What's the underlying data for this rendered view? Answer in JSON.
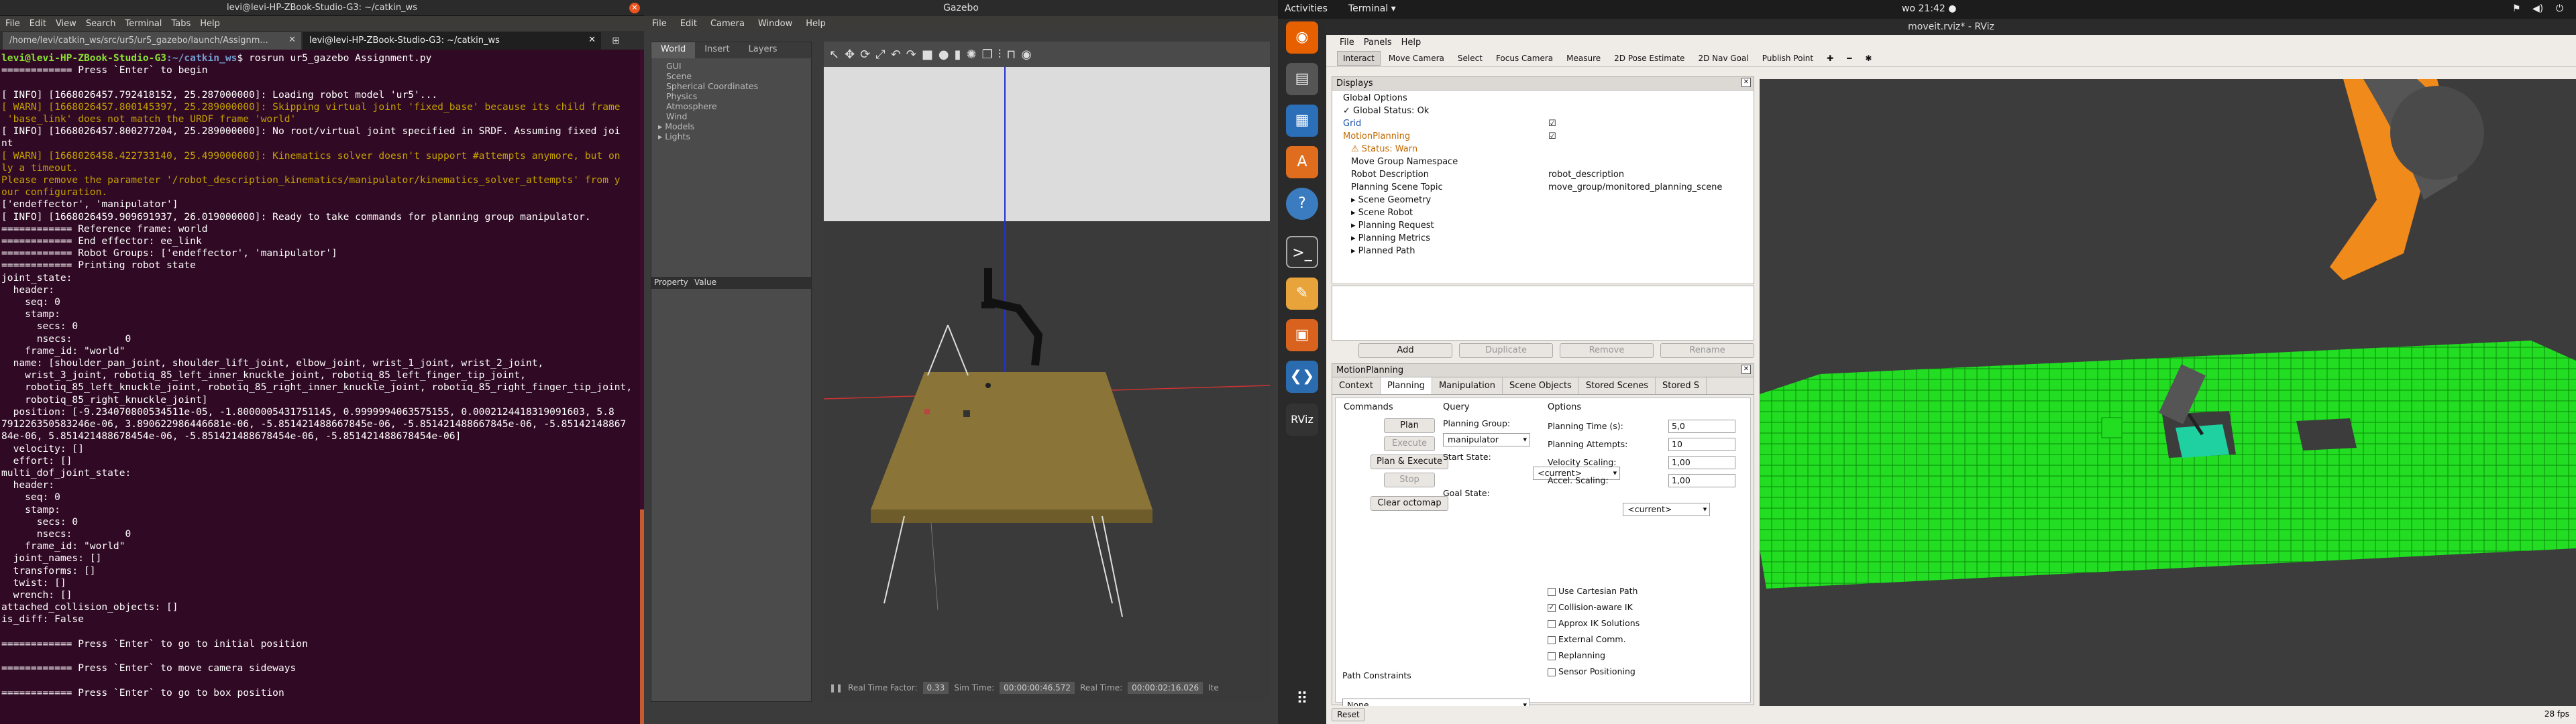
{
  "terminal": {
    "title": "levi@levi-HP-ZBook-Studio-G3: ~/catkin_ws",
    "menu": [
      "File",
      "Edit",
      "View",
      "Search",
      "Terminal",
      "Tabs",
      "Help"
    ],
    "tabs": [
      "/home/levi/catkin_ws/src/ur5/ur5_gazebo/launch/Assignm...",
      "levi@levi-HP-ZBook-Studio-G3: ~/catkin_ws"
    ],
    "prompt": "levi@levi-HP-ZBook-Studio-G3",
    "path": ":~/catkin_ws",
    "command": "$ rosrun ur5_gazebo Assignment.py",
    "lines": [
      {
        "t": "============ Press `Enter` to begin",
        "c": ""
      },
      {
        "t": "",
        "c": ""
      },
      {
        "t": "[ INFO] [1668026457.792418152, 25.287000000]: Loading robot model 'ur5'...",
        "c": ""
      },
      {
        "t": "[ WARN] [1668026457.800145397, 25.289000000]: Skipping virtual joint 'fixed_base' because its child frame",
        "c": "w"
      },
      {
        "t": " 'base_link' does not match the URDF frame 'world'",
        "c": "w"
      },
      {
        "t": "[ INFO] [1668026457.800277204, 25.289000000]: No root/virtual joint specified in SRDF. Assuming fixed joi",
        "c": ""
      },
      {
        "t": "nt",
        "c": ""
      },
      {
        "t": "[ WARN] [1668026458.422733140, 25.499000000]: Kinematics solver doesn't support #attempts anymore, but on",
        "c": "w"
      },
      {
        "t": "ly a timeout.",
        "c": "w"
      },
      {
        "t": "Please remove the parameter '/robot_description_kinematics/manipulator/kinematics_solver_attempts' from y",
        "c": "w"
      },
      {
        "t": "our configuration.",
        "c": "w"
      },
      {
        "t": "['endeffector', 'manipulator']",
        "c": ""
      },
      {
        "t": "[ INFO] [1668026459.909691937, 26.019000000]: Ready to take commands for planning group manipulator.",
        "c": ""
      },
      {
        "t": "============ Reference frame: world",
        "c": ""
      },
      {
        "t": "============ End effector: ee_link",
        "c": ""
      },
      {
        "t": "============ Robot Groups: ['endeffector', 'manipulator']",
        "c": ""
      },
      {
        "t": "============ Printing robot state",
        "c": ""
      },
      {
        "t": "joint_state:",
        "c": ""
      },
      {
        "t": "  header:",
        "c": ""
      },
      {
        "t": "    seq: 0",
        "c": ""
      },
      {
        "t": "    stamp:",
        "c": ""
      },
      {
        "t": "      secs: 0",
        "c": ""
      },
      {
        "t": "      nsecs:         0",
        "c": ""
      },
      {
        "t": "    frame_id: \"world\"",
        "c": ""
      },
      {
        "t": "  name: [shoulder_pan_joint, shoulder_lift_joint, elbow_joint, wrist_1_joint, wrist_2_joint,",
        "c": ""
      },
      {
        "t": "    wrist_3_joint, robotiq_85_left_inner_knuckle_joint, robotiq_85_left_finger_tip_joint,",
        "c": ""
      },
      {
        "t": "    robotiq_85_left_knuckle_joint, robotiq_85_right_inner_knuckle_joint, robotiq_85_right_finger_tip_joint,",
        "c": ""
      },
      {
        "t": "    robotiq_85_right_knuckle_joint]",
        "c": ""
      },
      {
        "t": "  position: [-9.234070800534511e-05, -1.8000005431751145, 0.9999994063575155, 0.0002124418319091603, 5.8",
        "c": ""
      },
      {
        "t": "791226350583246e-06, 3.890622986446681e-06, -5.851421488667845e-06, -5.851421488667845e-06, -5.85142148867",
        "c": ""
      },
      {
        "t": "84e-06, 5.851421488678454e-06, -5.851421488678454e-06, -5.851421488678454e-06]",
        "c": ""
      },
      {
        "t": "  velocity: []",
        "c": ""
      },
      {
        "t": "  effort: []",
        "c": ""
      },
      {
        "t": "multi_dof_joint_state:",
        "c": ""
      },
      {
        "t": "  header:",
        "c": ""
      },
      {
        "t": "    seq: 0",
        "c": ""
      },
      {
        "t": "    stamp:",
        "c": ""
      },
      {
        "t": "      secs: 0",
        "c": ""
      },
      {
        "t": "      nsecs:         0",
        "c": ""
      },
      {
        "t": "    frame_id: \"world\"",
        "c": ""
      },
      {
        "t": "  joint_names: []",
        "c": ""
      },
      {
        "t": "  transforms: []",
        "c": ""
      },
      {
        "t": "  twist: []",
        "c": ""
      },
      {
        "t": "  wrench: []",
        "c": ""
      },
      {
        "t": "attached_collision_objects: []",
        "c": ""
      },
      {
        "t": "is_diff: False",
        "c": ""
      },
      {
        "t": "",
        "c": ""
      },
      {
        "t": "============ Press `Enter` to go to initial position",
        "c": ""
      },
      {
        "t": "",
        "c": ""
      },
      {
        "t": "============ Press `Enter` to move camera sideways",
        "c": ""
      },
      {
        "t": "",
        "c": ""
      },
      {
        "t": "============ Press `Enter` to go to box position",
        "c": ""
      }
    ]
  },
  "gazebo": {
    "title": "Gazebo",
    "menu": [
      "File",
      "Edit",
      "Camera",
      "Window",
      "Help"
    ],
    "tabs": [
      "World",
      "Insert",
      "Layers"
    ],
    "tree": [
      {
        "label": "GUI",
        "indent": 1
      },
      {
        "label": "Scene",
        "indent": 1
      },
      {
        "label": "Spherical Coordinates",
        "indent": 1
      },
      {
        "label": "Physics",
        "indent": 1
      },
      {
        "label": "Atmosphere",
        "indent": 1
      },
      {
        "label": "Wind",
        "indent": 1
      },
      {
        "label": "▸ Models",
        "indent": 0
      },
      {
        "label": "▸ Lights",
        "indent": 0
      }
    ],
    "prop_headers": [
      "Property",
      "Value"
    ],
    "rtf_label": "Real Time Factor:",
    "rtf_value": "0.33",
    "sim_label": "Sim Time:",
    "sim_value": "00:00:00:46.572",
    "real_label": "Real Time:",
    "real_value": "00:00:02:16.026",
    "it_label": "Ite"
  },
  "topbar": {
    "activities": "Activities",
    "app": "Terminal ▾",
    "clock": "wo 21:42 ●"
  },
  "rviz": {
    "title": "moveit.rviz* - RViz",
    "menu": [
      "File",
      "Panels",
      "Help"
    ],
    "tools": [
      "Interact",
      "Move Camera",
      "Select",
      "Focus Camera",
      "Measure",
      "2D Pose Estimate",
      "2D Nav Goal",
      "Publish Point"
    ],
    "displays_title": "Displays",
    "displays": [
      {
        "label": "Global Options",
        "c2": "",
        "level": 0,
        "col": "#111"
      },
      {
        "label": "✓ Global Status: Ok",
        "c2": "",
        "level": 0,
        "col": "#111"
      },
      {
        "label": "Grid",
        "c2": "☑",
        "level": 0,
        "col": "#1d4fa8"
      },
      {
        "label": "MotionPlanning",
        "c2": "☑",
        "level": 0,
        "col": "#c26a00"
      },
      {
        "label": "⚠ Status: Warn",
        "c2": "",
        "level": 1,
        "col": "#c26a00"
      },
      {
        "label": "Move Group Namespace",
        "c2": "",
        "level": 1,
        "col": "#111"
      },
      {
        "label": "Robot Description",
        "c2": "robot_description",
        "level": 1,
        "col": "#111"
      },
      {
        "label": "Planning Scene Topic",
        "c2": "move_group/monitored_planning_scene",
        "level": 1,
        "col": "#111"
      },
      {
        "label": "▸ Scene Geometry",
        "c2": "",
        "level": 1,
        "col": "#111"
      },
      {
        "label": "▸ Scene Robot",
        "c2": "",
        "level": 1,
        "col": "#111"
      },
      {
        "label": "▸ Planning Request",
        "c2": "",
        "level": 1,
        "col": "#111"
      },
      {
        "label": "▸ Planning Metrics",
        "c2": "",
        "level": 1,
        "col": "#111"
      },
      {
        "label": "▸ Planned Path",
        "c2": "",
        "level": 1,
        "col": "#111"
      }
    ],
    "disp_buttons": [
      "Add",
      "Duplicate",
      "Remove",
      "Rename"
    ],
    "mp_title": "MotionPlanning",
    "mp_tabs": [
      "Context",
      "Planning",
      "Manipulation",
      "Scene Objects",
      "Stored Scenes",
      "Stored S"
    ],
    "commands_title": "Commands",
    "cmd_buttons": [
      "Plan",
      "Execute",
      "Plan & Execute",
      "Stop",
      "Clear octomap"
    ],
    "query_title": "Query",
    "planning_group_label": "Planning Group:",
    "planning_group_value": "manipulator",
    "start_state_label": "Start State:",
    "start_state_value": "<current>",
    "goal_state_label": "Goal State:",
    "goal_state_value": "<current>",
    "options_title": "Options",
    "options": [
      {
        "label": "Planning Time (s):",
        "value": "5,0"
      },
      {
        "label": "Planning Attempts:",
        "value": "10"
      },
      {
        "label": "Velocity Scaling:",
        "value": "1,00"
      },
      {
        "label": "Accel. Scaling:",
        "value": "1,00"
      }
    ],
    "checkboxes": [
      {
        "label": "Use Cartesian Path",
        "checked": false
      },
      {
        "label": "Collision-aware IK",
        "checked": true
      },
      {
        "label": "Approx IK Solutions",
        "checked": false
      },
      {
        "label": "External Comm.",
        "checked": false
      },
      {
        "label": "Replanning",
        "checked": false
      },
      {
        "label": "Sensor Positioning",
        "checked": false
      }
    ],
    "path_constraints_title": "Path Constraints",
    "path_constraints_value": "None",
    "reset": "Reset",
    "fps": "28 fps"
  }
}
